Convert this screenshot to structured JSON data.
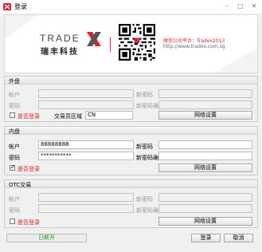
{
  "window": {
    "title": "登录"
  },
  "banner": {
    "logo_word": "TRADE",
    "logo_cn": "瑞丰科技",
    "wechat": "微信公众平台：Tradex2013",
    "url": "http://www.tradex.com.sg"
  },
  "outer": {
    "title": "外盘",
    "account_label": "帐户",
    "password_label": "密码",
    "new_password_label": "新密码",
    "confirm_label": "新密码确认",
    "remember_label": "是否登录",
    "region_label": "交易员区域",
    "region_value": "CN",
    "net_button": "网络设置"
  },
  "inner": {
    "title": "内盘",
    "account_label": "帐户",
    "account_value": "88888888",
    "password_label": "密码",
    "password_value": "***********",
    "new_password_label": "新密码",
    "confirm_label": "新密码确认",
    "remember_label": "是否登录",
    "net_button": "网络设置"
  },
  "otc": {
    "title": "OTC交易",
    "account_label": "帐户",
    "password_label": "密码",
    "new_password_label": "新密码",
    "confirm_label": "新密码确认",
    "remember_label": "是否登录",
    "net_button": "网络设置"
  },
  "footer": {
    "status": "已断开",
    "login": "登录",
    "cancel": "取消"
  },
  "colors": {
    "accent": "#d9232e",
    "status": "#2e8b2e"
  }
}
